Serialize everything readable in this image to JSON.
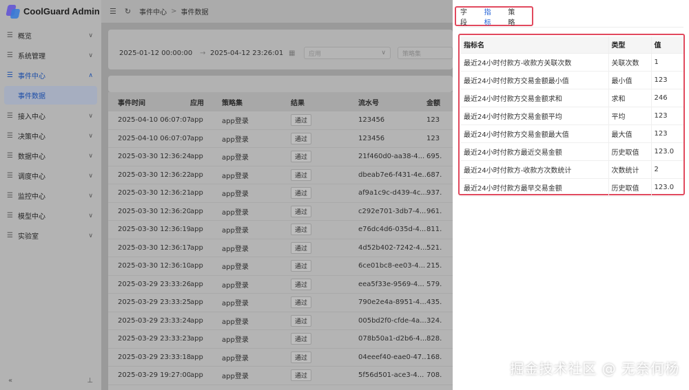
{
  "app": {
    "title": "CoolGuard Admin"
  },
  "sidebar": {
    "items": [
      {
        "icon": "menu-icon",
        "label": "概览",
        "chevron": "∨"
      },
      {
        "icon": "menu-icon",
        "label": "系统管理",
        "chevron": "∨"
      },
      {
        "icon": "menu-icon",
        "label": "事件中心",
        "chevron": "∧"
      },
      {
        "icon": "menu-icon",
        "label": "接入中心",
        "chevron": "∨"
      },
      {
        "icon": "menu-icon",
        "label": "决策中心",
        "chevron": "∨"
      },
      {
        "icon": "menu-icon",
        "label": "数据中心",
        "chevron": "∨"
      },
      {
        "icon": "menu-icon",
        "label": "调度中心",
        "chevron": "∨"
      },
      {
        "icon": "menu-icon",
        "label": "监控中心",
        "chevron": "∨"
      },
      {
        "icon": "menu-icon",
        "label": "模型中心",
        "chevron": "∨"
      },
      {
        "icon": "menu-icon",
        "label": "实验室",
        "chevron": "∨"
      }
    ],
    "sub_item": "事件数据",
    "footer_left": "«",
    "footer_right": "⊥"
  },
  "topbar": {
    "breadcrumb": [
      "事件中心",
      "事件数据"
    ],
    "sep": ">"
  },
  "filters": {
    "start": "2025-01-12 00:00:00",
    "end": "2025-04-12 23:26:01",
    "arrow": "→",
    "app_placeholder": "应用",
    "strategy_placeholder": "策略集"
  },
  "table": {
    "headers": [
      "事件时间",
      "应用",
      "策略集",
      "结果",
      "流水号",
      "金额"
    ],
    "rows": [
      [
        "2025-04-10 06:07:07",
        "app",
        "app登录",
        "通过",
        "123456",
        "123"
      ],
      [
        "2025-04-10 06:07:07",
        "app",
        "app登录",
        "通过",
        "123456",
        "123"
      ],
      [
        "2025-03-30 12:36:24",
        "app",
        "app登录",
        "通过",
        "21f460d0-aa38-4...",
        "695."
      ],
      [
        "2025-03-30 12:36:22",
        "app",
        "app登录",
        "通过",
        "dbeab7e6-f431-4e...",
        "687."
      ],
      [
        "2025-03-30 12:36:21",
        "app",
        "app登录",
        "通过",
        "af9a1c9c-d439-4c...",
        "937."
      ],
      [
        "2025-03-30 12:36:20",
        "app",
        "app登录",
        "通过",
        "c292e701-3db7-4...",
        "961."
      ],
      [
        "2025-03-30 12:36:19",
        "app",
        "app登录",
        "通过",
        "e76dc4d6-035d-4...",
        "811."
      ],
      [
        "2025-03-30 12:36:17",
        "app",
        "app登录",
        "通过",
        "4d52b402-7242-4...",
        "521."
      ],
      [
        "2025-03-30 12:36:10",
        "app",
        "app登录",
        "通过",
        "6ce01bc8-ee03-4...",
        "215."
      ],
      [
        "2025-03-29 23:33:26",
        "app",
        "app登录",
        "通过",
        "eea5f33e-9569-4...",
        "579."
      ],
      [
        "2025-03-29 23:33:25",
        "app",
        "app登录",
        "通过",
        "790e2e4a-8951-4...",
        "435."
      ],
      [
        "2025-03-29 23:33:24",
        "app",
        "app登录",
        "通过",
        "005bd2f0-cfde-4a...",
        "324."
      ],
      [
        "2025-03-29 23:33:23",
        "app",
        "app登录",
        "通过",
        "078b50a1-d2b6-4...",
        "828."
      ],
      [
        "2025-03-29 23:33:18",
        "app",
        "app登录",
        "通过",
        "04eeef40-eae0-47...",
        "168."
      ],
      [
        "2025-03-29 19:27:00",
        "app",
        "app登录",
        "通过",
        "5f56d501-ace3-4...",
        "708."
      ]
    ]
  },
  "drawer": {
    "tabs": [
      "字段",
      "指标",
      "策略"
    ],
    "active_tab": 1,
    "metric_headers": [
      "指标名",
      "类型",
      "值"
    ],
    "metrics": [
      [
        "最近24小时付款方-收款方关联次数",
        "关联次数",
        "1"
      ],
      [
        "最近24小时付款方交易金额最小值",
        "最小值",
        "123"
      ],
      [
        "最近24小时付款方交易金额求和",
        "求和",
        "246"
      ],
      [
        "最近24小时付款方交易金额平均",
        "平均",
        "123"
      ],
      [
        "最近24小时付款方交易金额最大值",
        "最大值",
        "123"
      ],
      [
        "最近24小时付款方最近交易金额",
        "历史取值",
        "123.0"
      ],
      [
        "最近24小时付款方-收款方次数统计",
        "次数统计",
        "2"
      ],
      [
        "最近24小时付款方最早交易金额",
        "历史取值",
        "123.0"
      ]
    ]
  },
  "watermark": "掘金技术社区 @ 无奈何杨",
  "colors": {
    "accent": "#1f5fd6",
    "highlight": "#e1485d"
  }
}
